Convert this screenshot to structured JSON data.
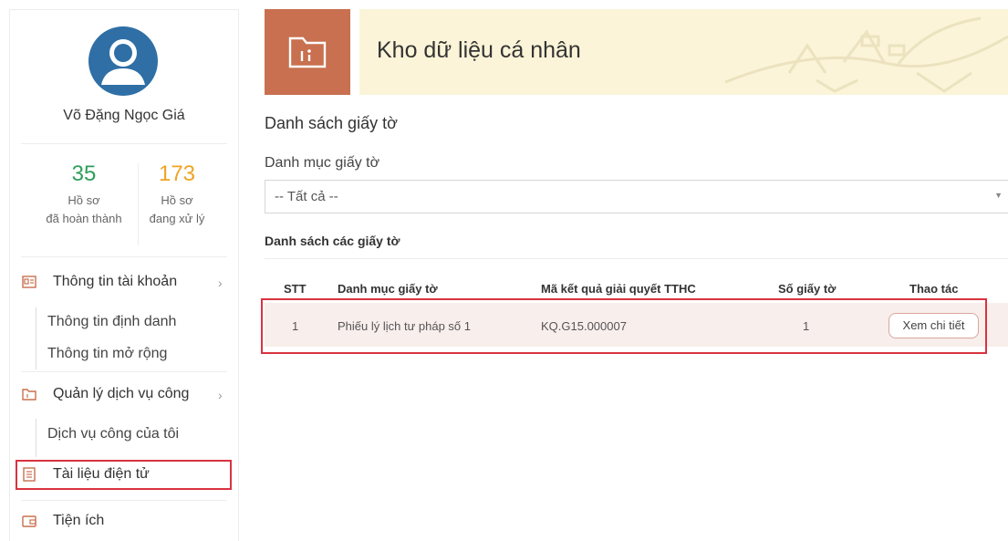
{
  "user": {
    "name": "Võ Đặng Ngọc Giá"
  },
  "stats": [
    {
      "value": "35",
      "label_line1": "Hồ sơ",
      "label_line2": "đã hoàn thành",
      "color": "#2e9e5b"
    },
    {
      "value": "173",
      "label_line1": "Hồ sơ",
      "label_line2": "đang xử lý",
      "color": "#f0a323"
    }
  ],
  "nav": {
    "account": {
      "label": "Thông tin tài khoản",
      "chevron": "›",
      "icon": "id-card-icon"
    },
    "account_items": [
      "Thông tin định danh",
      "Thông tin mở rộng"
    ],
    "services": {
      "label": "Quản lý dịch vụ công",
      "chevron": "›",
      "icon": "folder-icon"
    },
    "services_items": [
      "Dịch vụ công của tôi"
    ],
    "documents": {
      "label": "Tài liệu điện tử",
      "icon": "document-icon"
    },
    "utilities": {
      "label": "Tiện ích",
      "icon": "wallet-icon"
    }
  },
  "banner": {
    "title": "Kho dữ liệu cá nhân",
    "accent": "#c8704f"
  },
  "main": {
    "section_title": "Danh sách giấy tờ",
    "filter_label": "Danh mục giấy tờ",
    "filter_value": "-- Tất cả --",
    "list_title": "Danh sách các giấy tờ"
  },
  "table": {
    "headers": [
      "STT",
      "Danh mục giấy tờ",
      "Mã kết quả giải quyết TTHC",
      "Số giấy tờ",
      "Thao tác"
    ],
    "rows": [
      {
        "stt": "1",
        "category": "Phiếu lý lịch tư pháp số 1",
        "code": "KQ.G15.000007",
        "count": "1",
        "action": "Xem chi tiết"
      }
    ]
  },
  "colors": {
    "highlight": "#d9333f",
    "row_bg": "#f8eeec",
    "banner_bg": "#fbf4d8"
  }
}
